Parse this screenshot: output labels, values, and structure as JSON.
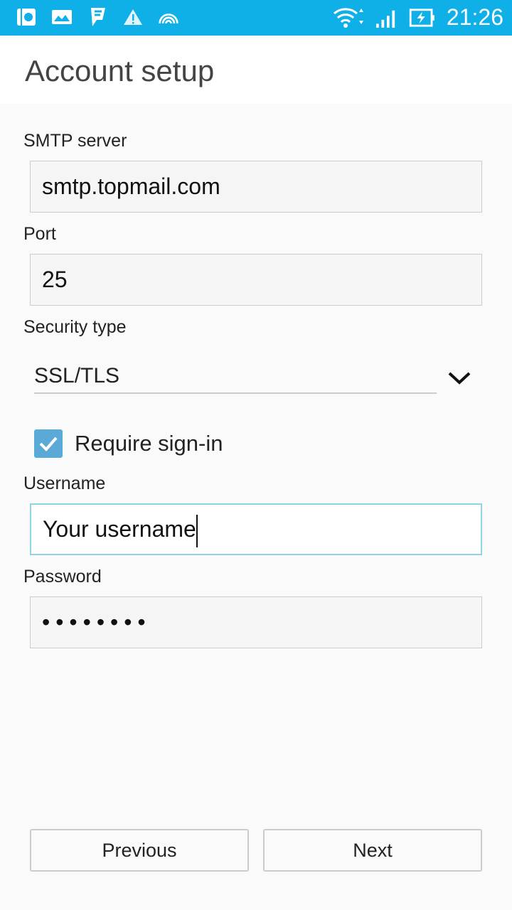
{
  "status_bar": {
    "time": "21:26",
    "icons": [
      "clock-app-icon",
      "gallery-icon",
      "foursquare-icon",
      "warning-icon",
      "nfc-icon",
      "wifi-icon",
      "signal-icon",
      "battery-charging-icon"
    ]
  },
  "header": {
    "title": "Account setup"
  },
  "form": {
    "smtp_label": "SMTP server",
    "smtp_value": "smtp.topmail.com",
    "port_label": "Port",
    "port_value": "25",
    "security_label": "Security type",
    "security_value": "SSL/TLS",
    "require_signin_label": "Require sign-in",
    "require_signin_checked": true,
    "username_label": "Username",
    "username_value": "Your username",
    "password_label": "Password",
    "password_value": "••••••••"
  },
  "buttons": {
    "previous": "Previous",
    "next": "Next"
  },
  "colors": {
    "status_bar": "#0fb0e8",
    "checkbox": "#5aa9d6",
    "focus_border": "#8fd6e3"
  }
}
